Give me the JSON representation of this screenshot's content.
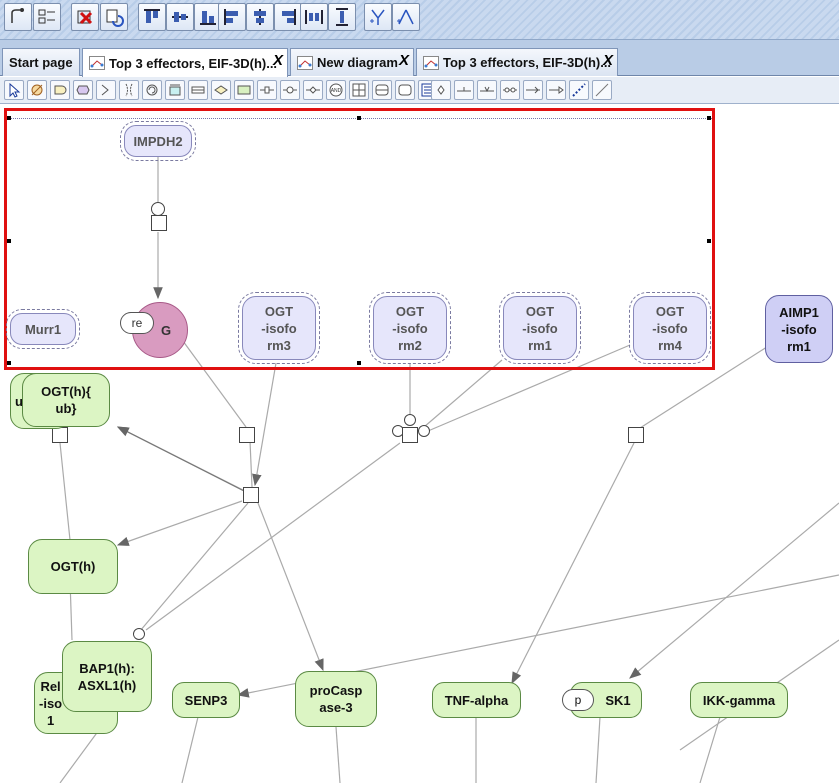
{
  "toolbar": {
    "buttons": [
      "connect-icon",
      "checklist-icon",
      "delete-icon",
      "refresh-icon",
      "align-top-icon",
      "align-middle-icon",
      "align-bottom-icon",
      "align-left-icon",
      "align-center-icon",
      "align-right-icon",
      "distribute-horizontal-icon",
      "distribute-vertical-icon",
      "layout-fork-icon",
      "layout-tree-icon"
    ]
  },
  "tabs": [
    {
      "label": "Start page",
      "closable": false,
      "active": false
    },
    {
      "label": "Top 3 effectors, EIF-3D(h)...",
      "closable": true,
      "active": true
    },
    {
      "label": "New diagram",
      "closable": true,
      "active": false
    },
    {
      "label": "Top 3 effectors, EIF-3D(h)...",
      "closable": true,
      "active": false
    }
  ],
  "tab_close_glyph": "X",
  "palette": {
    "tools": [
      "select-arrow-icon",
      "degradation-icon",
      "macromolecule-icon",
      "complex-icon",
      "compartment-icon",
      "clone-icon",
      "source-sink-icon",
      "rule-icon",
      "process-icon",
      "omitted-process-icon",
      "association-icon",
      "dissociation-icon",
      "and-icon",
      "or-icon",
      "not-icon",
      "tag-icon",
      "note-icon",
      "port-icon",
      "consumption-icon",
      "production-icon",
      "modulation-icon",
      "stimulation-icon",
      "catalysis-icon",
      "inhibition-icon",
      "dotted-line-icon",
      "line-icon"
    ]
  },
  "diagram": {
    "nodes": {
      "impdh2": "IMPDH2",
      "murr1": "Murr1",
      "g": "G",
      "g_state": "re",
      "ogt3": "OGT\n-isofo\nrm3",
      "ogt2": "OGT\n-isofo\nrm2",
      "ogt1": "OGT\n-isofo\nrm1",
      "ogt4": "OGT\n-isofo\nrm4",
      "aimp1": "AIMP1\n-isofo\nrm1",
      "u_hidden": "u",
      "ogt_ub": "OGT(h){\nub}",
      "ogt_h": "OGT(h)",
      "rel_hidden": "Rel\n-iso\n1",
      "bap1": "BAP1(h):\nASXL1(h)",
      "senp3": "SENP3",
      "procasp": "proCasp\nase-3",
      "tnf": "TNF-alpha",
      "sk1": "SK1",
      "sk1_state": "p",
      "ikk": "IKK-gamma"
    }
  },
  "colors": {
    "selection": "#e01010",
    "green_node": "#dcf5c4",
    "lavender_node": "#e6e6fb",
    "pink_node": "#d99bc0"
  }
}
